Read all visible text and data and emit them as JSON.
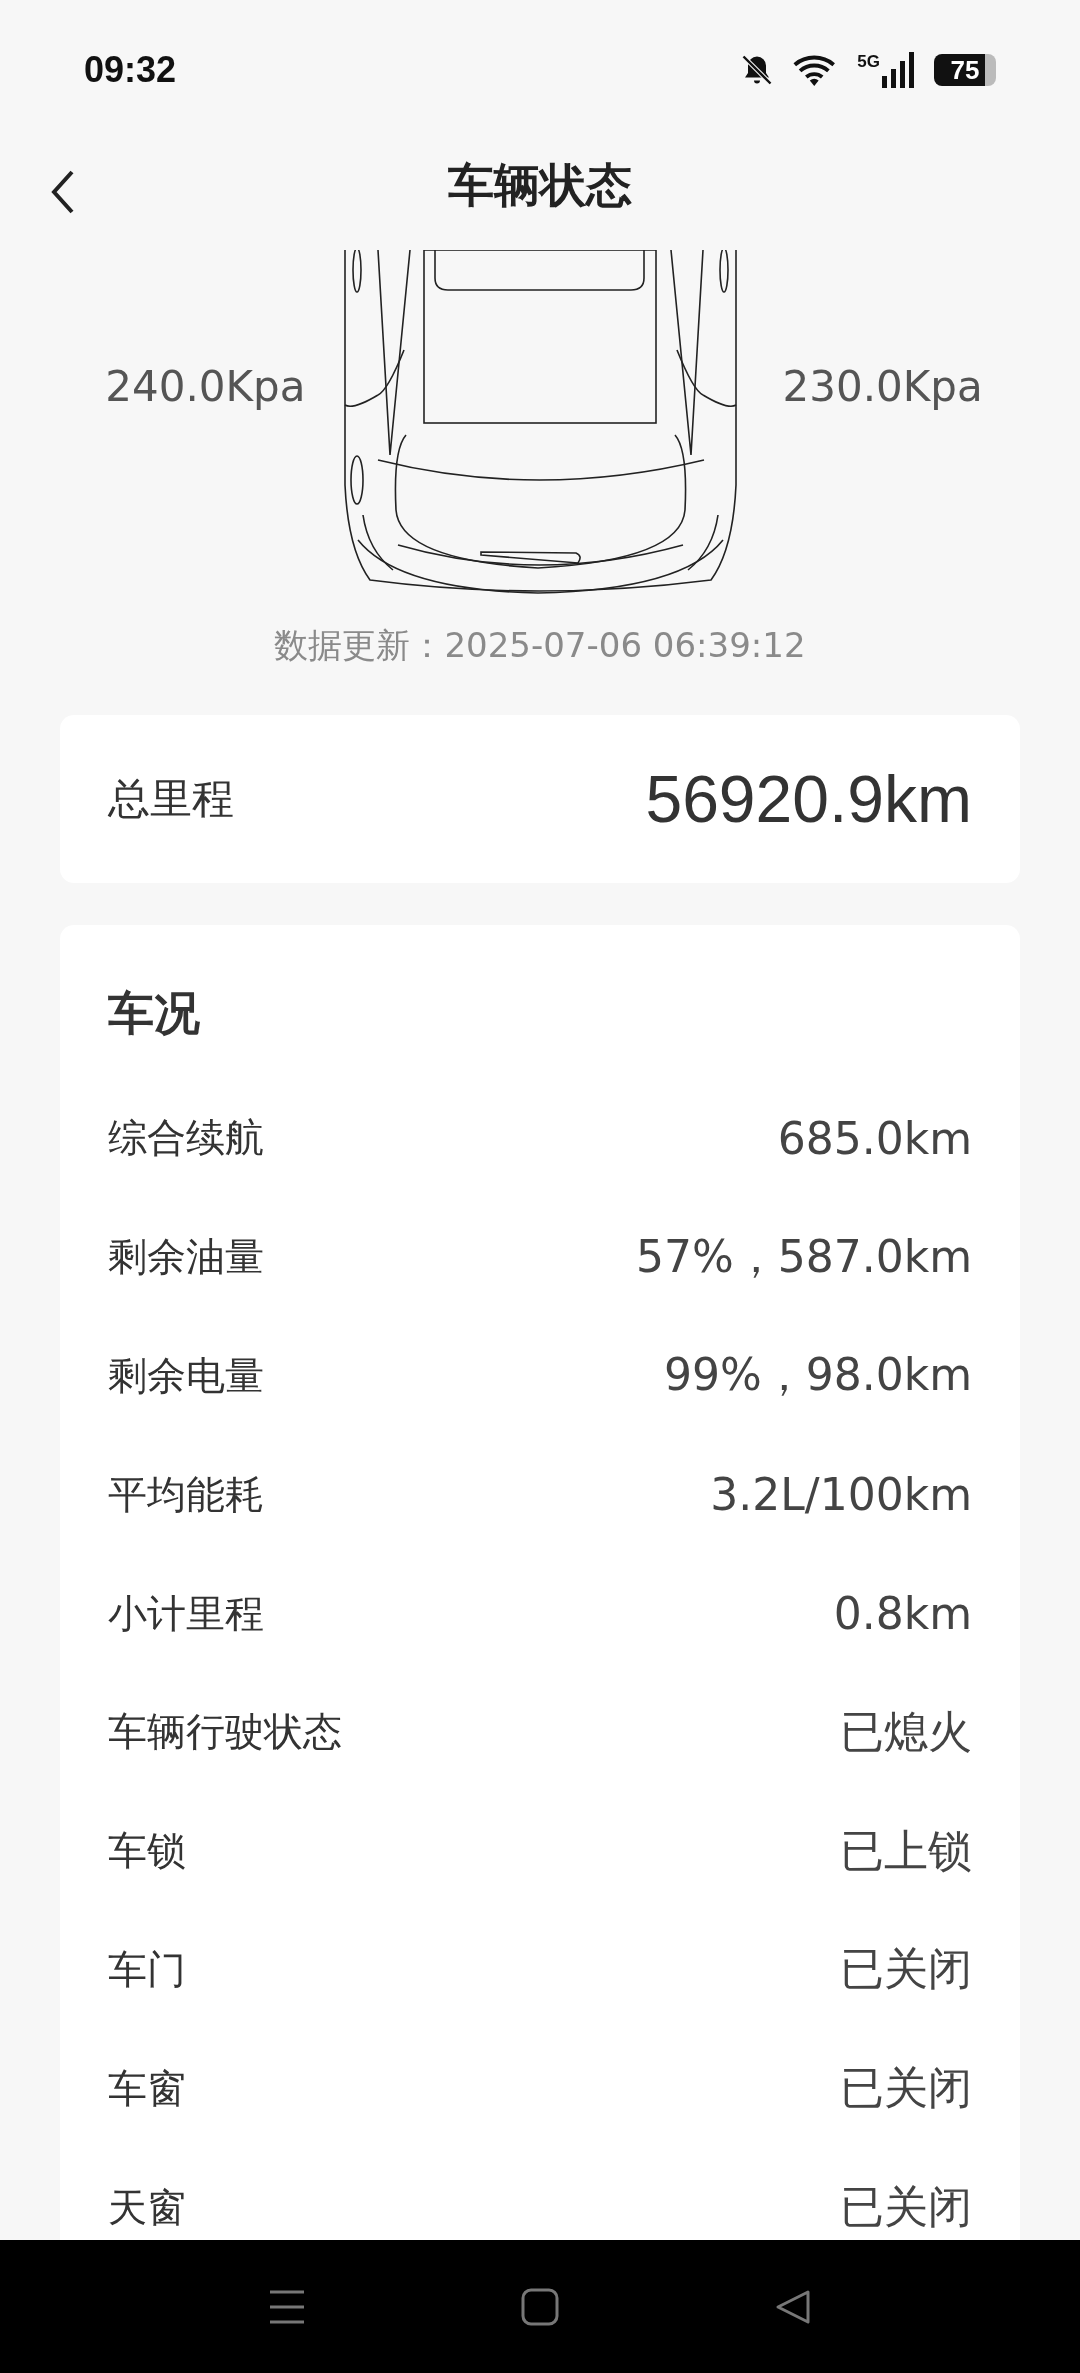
{
  "status_bar": {
    "time": "09:32",
    "network": "5G",
    "battery": "75"
  },
  "header": {
    "title": "车辆状态"
  },
  "tire_pressure": {
    "left": "240.0Kpa",
    "right": "230.0Kpa"
  },
  "update_time": "数据更新：2025-07-06 06:39:12",
  "odometer": {
    "label": "总里程",
    "value": "56920.9km"
  },
  "condition": {
    "title": "车况",
    "rows": [
      {
        "label": "综合续航",
        "value": "685.0km"
      },
      {
        "label": "剩余油量",
        "value": "57%，587.0km"
      },
      {
        "label": "剩余电量",
        "value": "99%，98.0km"
      },
      {
        "label": "平均能耗",
        "value": "3.2L/100km"
      },
      {
        "label": "小计里程",
        "value": "0.8km"
      },
      {
        "label": "车辆行驶状态",
        "value": "已熄火"
      },
      {
        "label": "车锁",
        "value": "已上锁"
      },
      {
        "label": "车门",
        "value": "已关闭"
      },
      {
        "label": "车窗",
        "value": "已关闭"
      },
      {
        "label": "天窗",
        "value": "已关闭"
      }
    ]
  }
}
